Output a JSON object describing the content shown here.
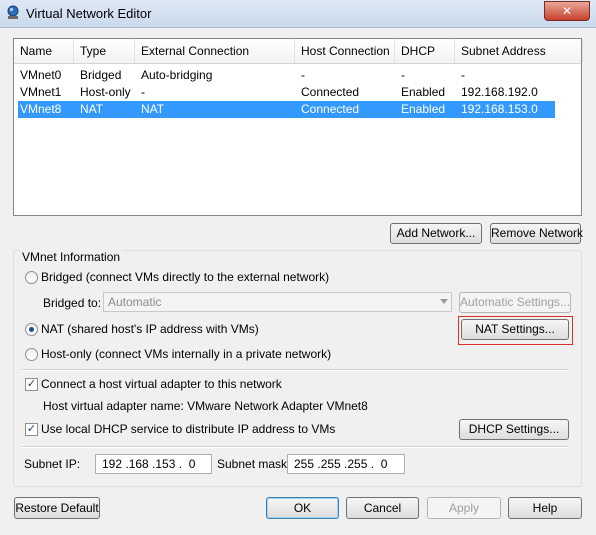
{
  "window": {
    "title": "Virtual Network Editor",
    "close_glyph": "✕",
    "icon": "vmware-network-icon"
  },
  "list": {
    "columns": [
      "Name",
      "Type",
      "External Connection",
      "Host Connection",
      "DHCP",
      "Subnet Address"
    ],
    "rows": [
      {
        "name": "VMnet0",
        "type": "Bridged",
        "external": "Auto-bridging",
        "host": "-",
        "dhcp": "-",
        "subnet": "-"
      },
      {
        "name": "VMnet1",
        "type": "Host-only",
        "external": "-",
        "host": "Connected",
        "dhcp": "Enabled",
        "subnet": "192.168.192.0"
      },
      {
        "name": "VMnet8",
        "type": "NAT",
        "external": "NAT",
        "host": "Connected",
        "dhcp": "Enabled",
        "subnet": "192.168.153.0"
      }
    ],
    "selected_index": 2
  },
  "buttons": {
    "add_network": "Add Network...",
    "remove_network": "Remove Network",
    "automatic_settings": "Automatic Settings...",
    "nat_settings": "NAT Settings...",
    "dhcp_settings": "DHCP Settings...",
    "restore_default": "Restore Default",
    "ok": "OK",
    "cancel": "Cancel",
    "apply": "Apply",
    "help": "Help"
  },
  "vmnet_info": {
    "group_title": "VMnet Information",
    "bridged_label": "Bridged (connect VMs directly to the external network)",
    "bridged_to_label": "Bridged to:",
    "bridged_to_value": "Automatic",
    "nat_label": "NAT (shared host's IP address with VMs)",
    "hostonly_label": "Host-only (connect VMs internally in a private network)",
    "selected_mode": "NAT",
    "connect_adapter_label": "Connect a host virtual adapter to this network",
    "connect_adapter_checked": true,
    "adapter_name_text": "Host virtual adapter name: VMware Network Adapter VMnet8",
    "dhcp_label": "Use local DHCP service to distribute IP address to VMs",
    "dhcp_checked": true,
    "subnet_ip_label": "Subnet IP:",
    "subnet_ip_value": "192 .168 .153 .  0",
    "subnet_mask_label": "Subnet mask:",
    "subnet_mask_value": "255 .255 .255 .  0"
  }
}
